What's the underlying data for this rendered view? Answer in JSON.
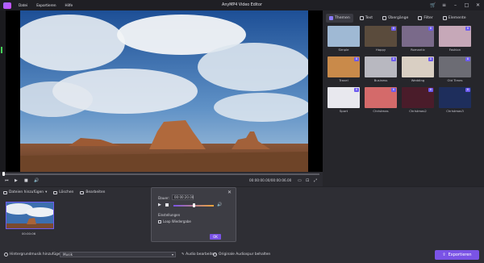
{
  "window": {
    "title": "AnyMP4 Video Editor",
    "menu": [
      "Datei",
      "Exportieren",
      "Hilfe"
    ]
  },
  "player": {
    "timecode": "00:00:00.00/00:00:06.00"
  },
  "panel": {
    "tabs": [
      {
        "label": "Themen",
        "active": true
      },
      {
        "label": "Text",
        "active": false
      },
      {
        "label": "Übergänge",
        "active": false
      },
      {
        "label": "Filter",
        "active": false
      },
      {
        "label": "Elemente",
        "active": false
      }
    ],
    "themes": [
      {
        "label": "Simple",
        "color": "#9fb9d4"
      },
      {
        "label": "Happy",
        "color": "#5a4b3c"
      },
      {
        "label": "Romantic",
        "color": "#7a6a8a"
      },
      {
        "label": "Fashion",
        "color": "#c6a8b8"
      },
      {
        "label": "Travel",
        "color": "#c98a4a"
      },
      {
        "label": "Business",
        "color": "#b8b8c0"
      },
      {
        "label": "Wedding",
        "color": "#d9cfc3"
      },
      {
        "label": "Old Times",
        "color": "#6c6c74"
      },
      {
        "label": "Sport",
        "color": "#e8e8ee"
      },
      {
        "label": "Christmas",
        "color": "#d46a6a"
      },
      {
        "label": "Christmas2",
        "color": "#4a1c2a"
      },
      {
        "label": "Christmas3",
        "color": "#1e2e5c"
      }
    ]
  },
  "toolbar": {
    "add_files": "Dateien hinzufügen",
    "delete": "Löschen",
    "edit": "Bearbeiten"
  },
  "clip": {
    "time": "00:00:06"
  },
  "footer": {
    "music_label": "Hintergrundmusik hinzufügen:",
    "music_value": "Musik",
    "audio_edit": "Audio bearbeiten",
    "keep_audio": "Originale Audiospur behalten",
    "export": "Exportieren"
  },
  "audio_popup": {
    "duration_label": "Dauer:",
    "duration_value": "00:00:20.00",
    "settings_label": "Einstellungen",
    "loop_label": "Loop Wiedergabe",
    "ok": "OK"
  }
}
